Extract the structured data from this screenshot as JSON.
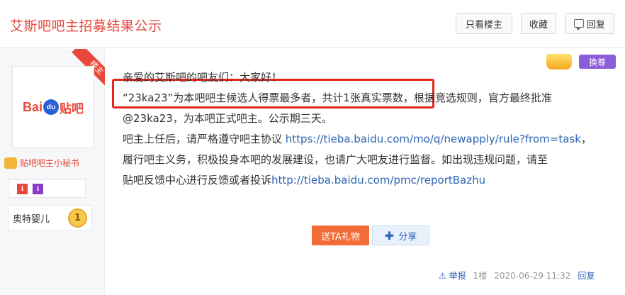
{
  "header": {
    "title": "艾斯吧吧主招募结果公示",
    "only_op_label": "只看楼主",
    "favorite_label": "收藏",
    "reply_label": "回复"
  },
  "user": {
    "op_ribbon": "楼主",
    "avatar_logo_text": "Bai",
    "avatar_logo_paw": "du",
    "avatar_logo_cn": "贴吧",
    "secretary_label": "贴吧吧主小秘书",
    "badges": [
      "i",
      "i"
    ],
    "username": "奥特婴儿",
    "level": "1"
  },
  "post": {
    "crown_label": "",
    "change_label": "换尊",
    "line1": "亲爱的艾斯吧的吧友们：大家好！",
    "line2_highlight": "“23ka23”为本吧吧主候选人得票最多者，共计1张真实票数，",
    "line2_rest": "根据竞选规则，官方最终批准",
    "line3": "@23ka23，为本吧正式吧主。公示期三天。",
    "line4_text": "吧主上任后，请严格遵守吧主协议 ",
    "line4_link": "https://tieba.baidu.com/mo/q/newapply/rule?from=task",
    "line4_end": "，",
    "line5": "履行吧主义务，积极投身本吧的发展建设，也请广大吧友进行监督。如出现违规问题，请至",
    "line6_text": "贴吧反馈中心进行反馈或者投诉",
    "line6_link": "http://tieba.baidu.com/pmc/reportBazhu",
    "gift_label": "送TA礼物",
    "share_label": "分享"
  },
  "footer": {
    "report_label": "举报",
    "floor": "1楼",
    "timestamp": "2020-06-29 11:32",
    "reply_label": "回复"
  },
  "colors": {
    "title_red": "#e8483c",
    "link_blue": "#2d64b3",
    "gift_orange": "#f26c35",
    "highlight_red": "#e5261c"
  }
}
